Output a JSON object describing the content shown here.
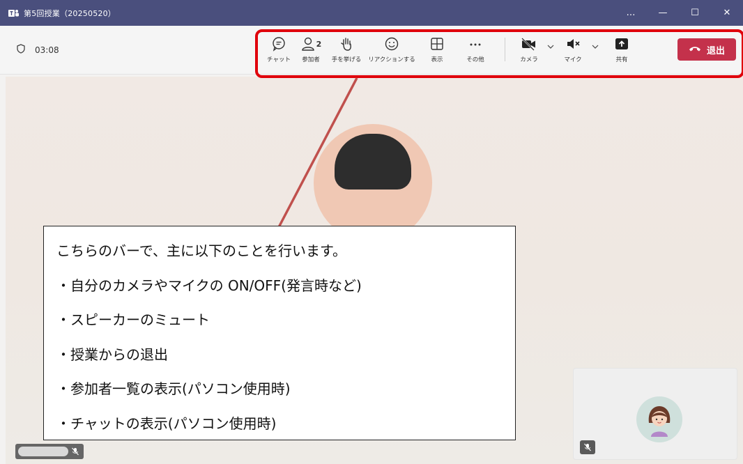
{
  "window": {
    "title": "第5回授業（20250520）",
    "controls": [
      "…",
      "—",
      "☐",
      "✕"
    ]
  },
  "meeting": {
    "timer": "03:08"
  },
  "toolbar": {
    "chat": "チャット",
    "participants": "参加者",
    "participant_count": "2",
    "raise_hand": "手を挙げる",
    "reactions": "リアクションする",
    "view": "表示",
    "more": "その他",
    "camera": "カメラ",
    "mic": "マイク",
    "share": "共有",
    "leave": "退出"
  },
  "callout": {
    "lines": [
      "こちらのバーで、主に以下のことを行います。",
      "・自分のカメラやマイクの ON/OFF(発言時など)",
      "・スピーカーのミュート",
      "・授業からの退出",
      "・参加者一覧の表示(パソコン使用時)",
      "・チャットの表示(パソコン使用時)"
    ]
  },
  "colors": {
    "titlebar": "#4a4f7d",
    "leave_button": "#c4314b",
    "highlight": "#e0000b",
    "callout_line": "#c0504d"
  }
}
